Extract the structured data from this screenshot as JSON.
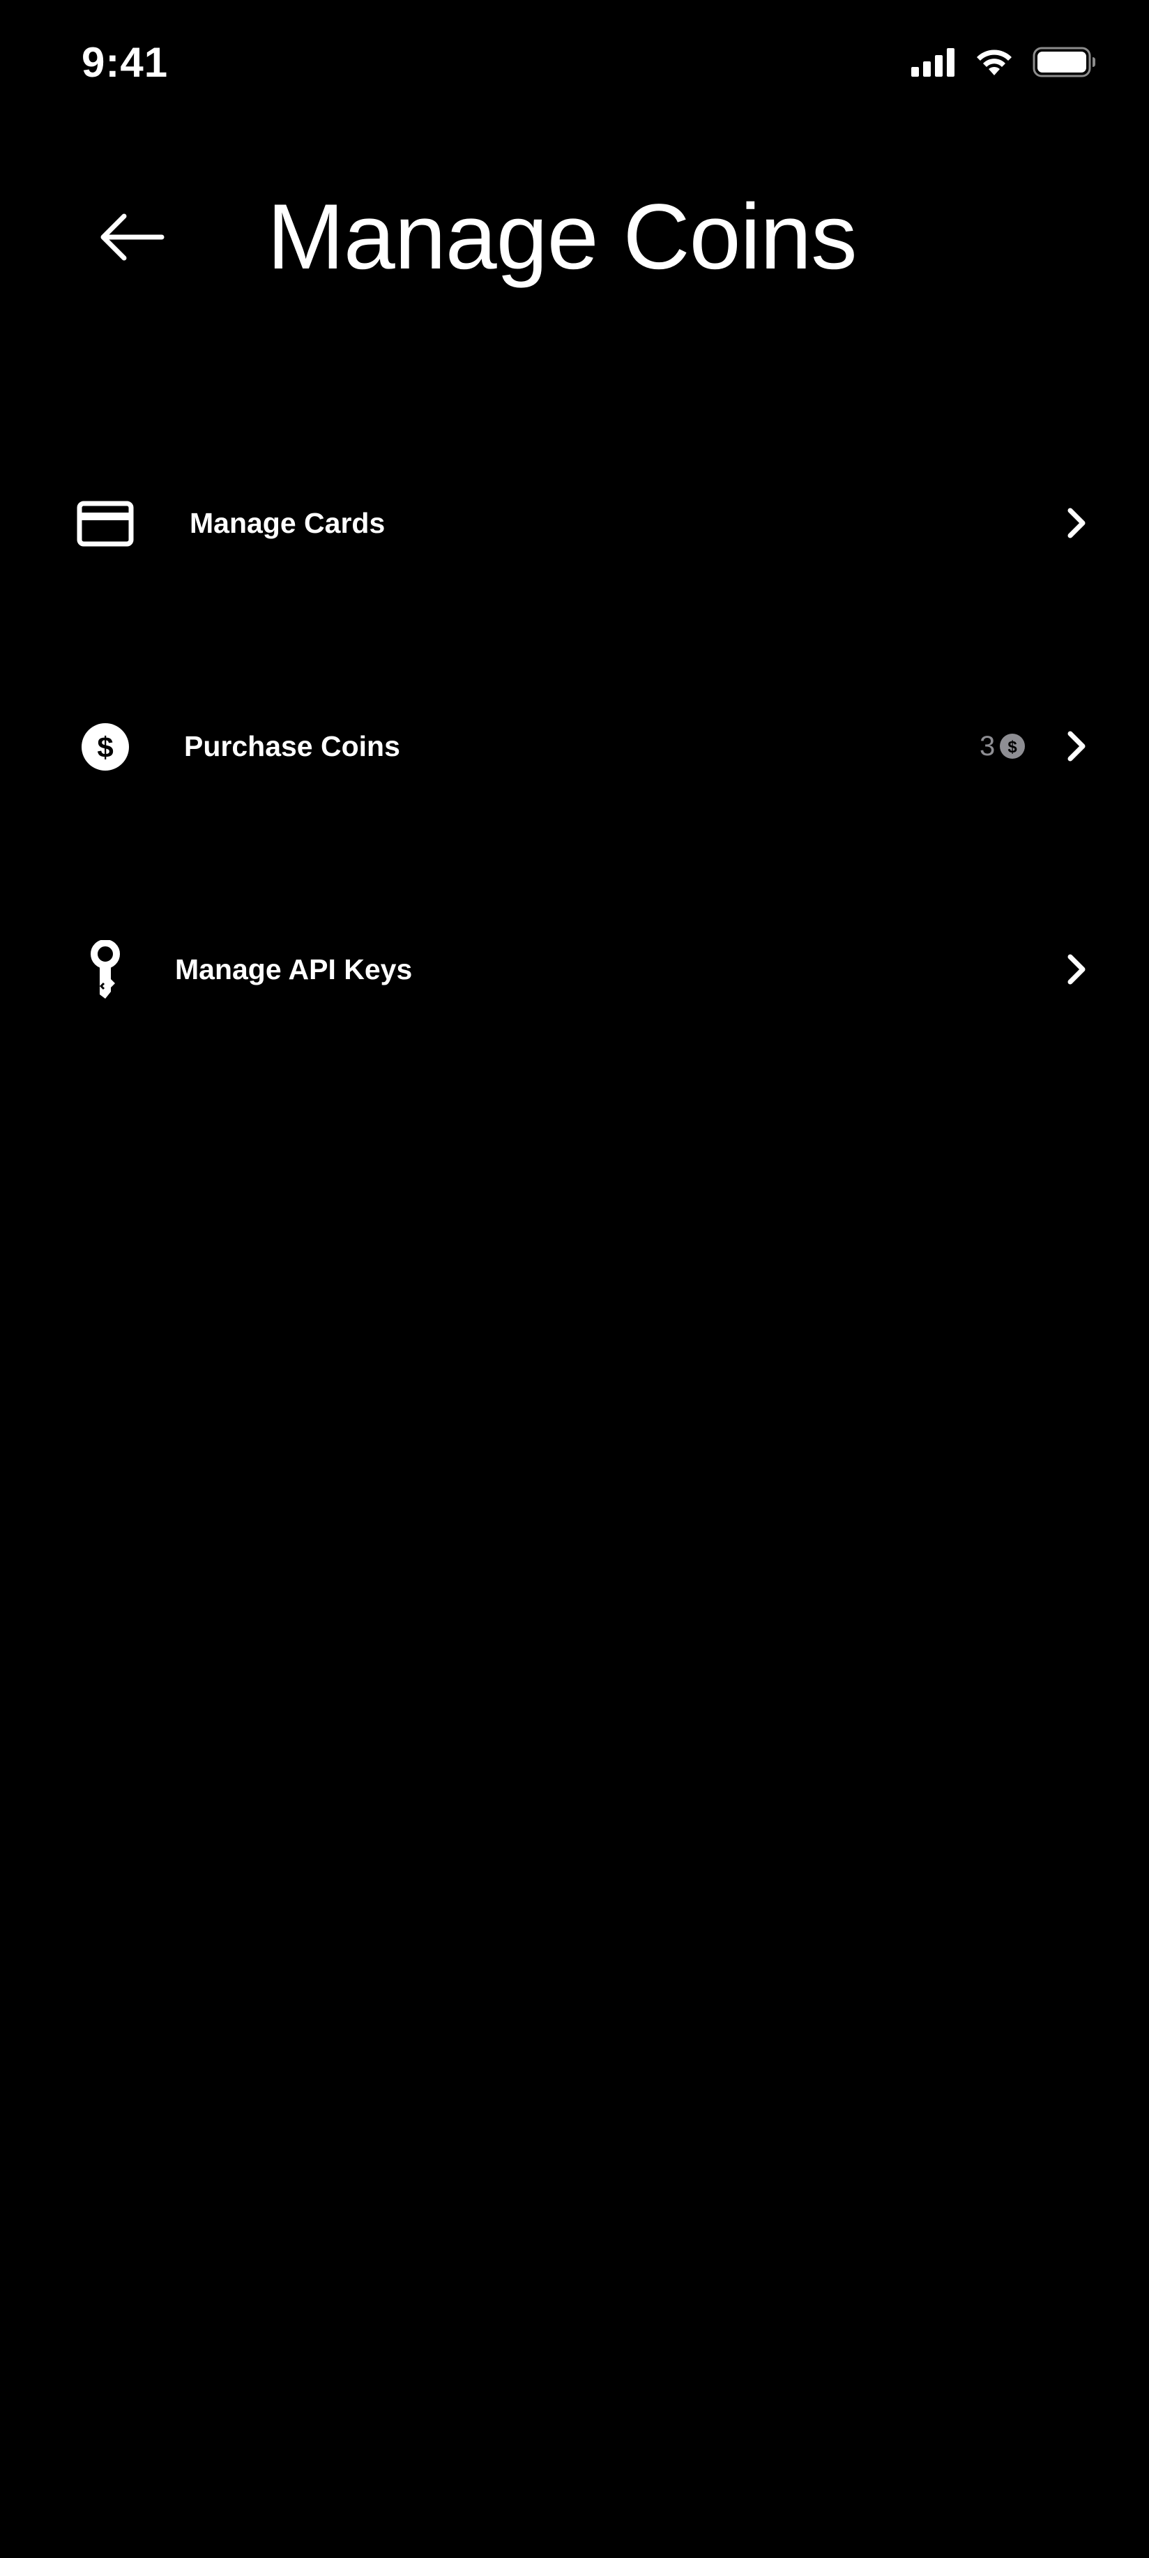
{
  "status_bar": {
    "time": "9:41",
    "icons": [
      "signal-icon",
      "wifi-icon",
      "battery-icon"
    ]
  },
  "header": {
    "back_icon": "arrow-left-icon",
    "title": "Manage Coins"
  },
  "menu": {
    "items": [
      {
        "icon": "credit-card-icon",
        "label": "Manage Cards",
        "trailing_icon": "chevron-right-icon"
      },
      {
        "icon": "dollar-coin-icon",
        "label": "Purchase Coins",
        "badge_value": "3",
        "badge_icon": "coin-icon",
        "trailing_icon": "chevron-right-icon"
      },
      {
        "icon": "key-icon",
        "label": "Manage API Keys",
        "trailing_icon": "chevron-right-icon"
      }
    ]
  },
  "colors": {
    "background": "#000000",
    "foreground": "#ffffff",
    "muted": "#8e8e93"
  }
}
